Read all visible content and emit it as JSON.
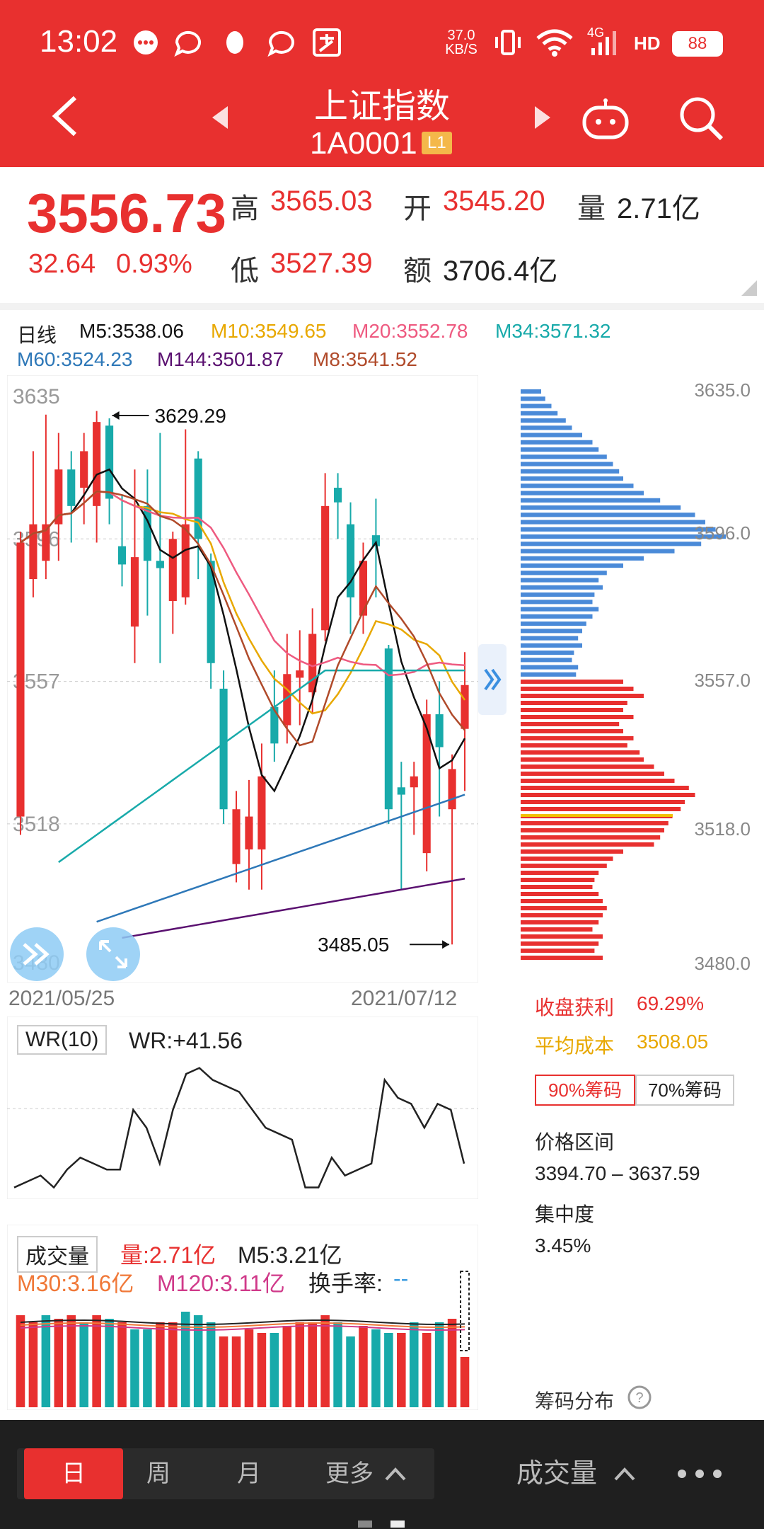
{
  "status_bar": {
    "time": "13:02",
    "net_speed_value": "37.0",
    "net_speed_unit": "KB/S",
    "network": "4G",
    "hd_label": "HD",
    "battery": "88",
    "icons": [
      "chat-bubble-icon",
      "message-icon",
      "qq-penguin-icon",
      "message-icon",
      "alipay-icon",
      "vibrate-icon",
      "wifi-icon",
      "signal-icon"
    ]
  },
  "header": {
    "title": "上证指数",
    "code": "1A0001",
    "level_badge": "L1",
    "icons": [
      "back-icon",
      "prev-icon",
      "next-icon",
      "robot-icon",
      "search-icon"
    ]
  },
  "quote": {
    "price": "3556.73",
    "change": "32.64",
    "change_pct": "0.93%",
    "high_label": "高",
    "high": "3565.03",
    "open_label": "开",
    "open": "3545.20",
    "volume_label": "量",
    "volume": "2.71亿",
    "low_label": "低",
    "low": "3527.39",
    "amount_label": "额",
    "amount": "3706.4亿"
  },
  "ma_legend": {
    "period": "日线",
    "items": [
      {
        "text": "M5:3538.06",
        "color": "#111111"
      },
      {
        "text": "M10:3549.65",
        "color": "#e8a800"
      },
      {
        "text": "M20:3552.78",
        "color": "#ee5a80"
      },
      {
        "text": "M34:3571.32",
        "color": "#18aaaa"
      },
      {
        "text": "M60:3524.23",
        "color": "#2e78b8"
      },
      {
        "text": "M144:3501.87",
        "color": "#5a1070"
      },
      {
        "text": "M8:3541.52",
        "color": "#b04a2a"
      }
    ]
  },
  "chart_data": [
    {
      "type": "candlestick",
      "y_ticks": [
        "3635",
        "3596",
        "3557",
        "3518",
        "3480"
      ],
      "ylim": [
        3480,
        3635
      ],
      "x_start": "2021/05/25",
      "x_end": "2021/07/12",
      "high_annotation": "3629.29",
      "low_annotation": "3485.05",
      "candles": [
        {
          "o": 3520,
          "c": 3595,
          "h": 3598,
          "l": 3515
        },
        {
          "o": 3585,
          "c": 3600,
          "h": 3620,
          "l": 3580
        },
        {
          "o": 3590,
          "c": 3600,
          "h": 3630,
          "l": 3585
        },
        {
          "o": 3600,
          "c": 3615,
          "h": 3625,
          "l": 3590
        },
        {
          "o": 3615,
          "c": 3605,
          "h": 3620,
          "l": 3595
        },
        {
          "o": 3610,
          "c": 3620,
          "h": 3625,
          "l": 3600
        },
        {
          "o": 3605,
          "c": 3628,
          "h": 3631,
          "l": 3595
        },
        {
          "o": 3627,
          "c": 3607,
          "h": 3629,
          "l": 3600
        },
        {
          "o": 3594,
          "c": 3589,
          "h": 3608,
          "l": 3583
        },
        {
          "o": 3572,
          "c": 3591,
          "h": 3615,
          "l": 3562
        },
        {
          "o": 3605,
          "c": 3590,
          "h": 3615,
          "l": 3575
        },
        {
          "o": 3590,
          "c": 3588,
          "h": 3625,
          "l": 3562
        },
        {
          "o": 3579,
          "c": 3596,
          "h": 3598,
          "l": 3570
        },
        {
          "o": 3580,
          "c": 3600,
          "h": 3626,
          "l": 3578
        },
        {
          "o": 3618,
          "c": 3596,
          "h": 3620,
          "l": 3585
        },
        {
          "o": 3590,
          "c": 3562,
          "h": 3592,
          "l": 3555
        },
        {
          "o": 3555,
          "c": 3522,
          "h": 3560,
          "l": 3518
        },
        {
          "o": 3507,
          "c": 3522,
          "h": 3527,
          "l": 3502
        },
        {
          "o": 3511,
          "c": 3520,
          "h": 3530,
          "l": 3500
        },
        {
          "o": 3511,
          "c": 3531,
          "h": 3540,
          "l": 3500
        },
        {
          "o": 3550,
          "c": 3540,
          "h": 3560,
          "l": 3535
        },
        {
          "o": 3545,
          "c": 3559,
          "h": 3570,
          "l": 3540
        },
        {
          "o": 3558,
          "c": 3560,
          "h": 3571,
          "l": 3545
        },
        {
          "o": 3554,
          "c": 3570,
          "h": 3577,
          "l": 3548
        },
        {
          "o": 3571,
          "c": 3605,
          "h": 3614,
          "l": 3568
        },
        {
          "o": 3610,
          "c": 3606,
          "h": 3614,
          "l": 3596
        },
        {
          "o": 3600,
          "c": 3580,
          "h": 3606,
          "l": 3570
        },
        {
          "o": 3575,
          "c": 3590,
          "h": 3595,
          "l": 3570
        },
        {
          "o": 3597,
          "c": 3594,
          "h": 3607,
          "l": 3580
        },
        {
          "o": 3566,
          "c": 3522,
          "h": 3567,
          "l": 3518
        },
        {
          "o": 3528,
          "c": 3526,
          "h": 3535,
          "l": 3500
        },
        {
          "o": 3528,
          "c": 3531,
          "h": 3535,
          "l": 3515
        },
        {
          "o": 3510,
          "c": 3548,
          "h": 3552,
          "l": 3505
        },
        {
          "o": 3548,
          "c": 3539,
          "h": 3557,
          "l": 3520
        },
        {
          "o": 3522,
          "c": 3533,
          "h": 3537,
          "l": 3485
        },
        {
          "o": 3544,
          "c": 3556,
          "h": 3565,
          "l": 3527
        }
      ],
      "ma_lines": [
        {
          "name": "M5",
          "color": "#111111"
        },
        {
          "name": "M10",
          "color": "#e8a800"
        },
        {
          "name": "M20",
          "color": "#ee5a80"
        },
        {
          "name": "M34",
          "color": "#18aaaa"
        },
        {
          "name": "M60",
          "color": "#2e78b8"
        },
        {
          "name": "M144",
          "color": "#5a1070"
        },
        {
          "name": "M8",
          "color": "#b04a2a"
        }
      ]
    },
    {
      "type": "line",
      "name": "WR(10)",
      "values": [
        2,
        4,
        6,
        2,
        8,
        12,
        10,
        8,
        8,
        28,
        22,
        10,
        28,
        40,
        42,
        38,
        36,
        34,
        28,
        22,
        20,
        18,
        2,
        2,
        12,
        6,
        8,
        10,
        38,
        32,
        30,
        22,
        30,
        28,
        10
      ]
    },
    {
      "type": "bar",
      "name": "成交量",
      "values": [
        3.3,
        3.2,
        3.3,
        3.25,
        3.3,
        3.2,
        3.3,
        3.25,
        3.2,
        3.1,
        3.1,
        3.2,
        3.2,
        3.35,
        3.3,
        3.2,
        3.0,
        3.0,
        3.1,
        3.05,
        3.05,
        3.15,
        3.2,
        3.2,
        3.3,
        3.2,
        3.0,
        3.15,
        3.1,
        3.05,
        3.05,
        3.2,
        3.05,
        3.2,
        3.25,
        2.71
      ],
      "colors": [
        "#e8302f",
        "#e8302f",
        "#18aaaa",
        "#e8302f",
        "#e8302f",
        "#18aaaa",
        "#e8302f",
        "#18aaaa",
        "#e8302f",
        "#18aaaa",
        "#18aaaa",
        "#e8302f",
        "#e8302f",
        "#18aaaa",
        "#18aaaa",
        "#18aaaa",
        "#e8302f",
        "#e8302f",
        "#e8302f",
        "#e8302f",
        "#18aaaa",
        "#e8302f",
        "#e8302f",
        "#e8302f",
        "#e8302f",
        "#18aaaa",
        "#18aaaa",
        "#e8302f",
        "#18aaaa",
        "#18aaaa",
        "#e8302f",
        "#18aaaa",
        "#e8302f",
        "#18aaaa",
        "#e8302f",
        "#e8302f"
      ]
    },
    {
      "type": "bar",
      "name": "chip-distribution",
      "y_ticks": [
        "3635.0",
        "3596.0",
        "3557.0",
        "3518.0",
        "3480.0"
      ],
      "upper_values": [
        0.1,
        0.12,
        0.15,
        0.18,
        0.22,
        0.25,
        0.3,
        0.35,
        0.38,
        0.42,
        0.45,
        0.48,
        0.5,
        0.55,
        0.6,
        0.68,
        0.78,
        0.85,
        0.9,
        0.95,
        1.0,
        0.88,
        0.75,
        0.6,
        0.5,
        0.42,
        0.38,
        0.4,
        0.36,
        0.35,
        0.38,
        0.35,
        0.32,
        0.3,
        0.28,
        0.3,
        0.26,
        0.25,
        0.28,
        0.27
      ],
      "lower_values": [
        0.5,
        0.55,
        0.6,
        0.52,
        0.5,
        0.55,
        0.48,
        0.5,
        0.55,
        0.52,
        0.58,
        0.6,
        0.65,
        0.7,
        0.75,
        0.82,
        0.85,
        0.8,
        0.78,
        0.74,
        0.72,
        0.7,
        0.68,
        0.65,
        0.5,
        0.45,
        0.42,
        0.38,
        0.36,
        0.35,
        0.38,
        0.4,
        0.42,
        0.4,
        0.38,
        0.35,
        0.4,
        0.38,
        0.36,
        0.4
      ]
    }
  ],
  "wr": {
    "label": "WR(10)",
    "value": "WR:+41.56"
  },
  "volume_panel": {
    "label": "成交量",
    "vol": "量:2.71亿",
    "m5": "M5:3.21亿",
    "m30": "M30:3.16亿",
    "m120": "M120:3.11亿",
    "turnover_label": "换手率:",
    "turnover_value": "--"
  },
  "chip_info": {
    "profit_label": "收盘获利",
    "profit": "69.29%",
    "avg_cost_label": "平均成本",
    "avg_cost": "3508.05",
    "tab_90": "90%筹码",
    "tab_70": "70%筹码",
    "range_label": "价格区间",
    "range": "3394.70 – 3637.59",
    "concentration_label": "集中度",
    "concentration": "3.45%",
    "footer": "筹码分布"
  },
  "bottom_tabs": {
    "day": "日",
    "week": "周",
    "month": "月",
    "more": "更多",
    "indicator": "成交量"
  }
}
